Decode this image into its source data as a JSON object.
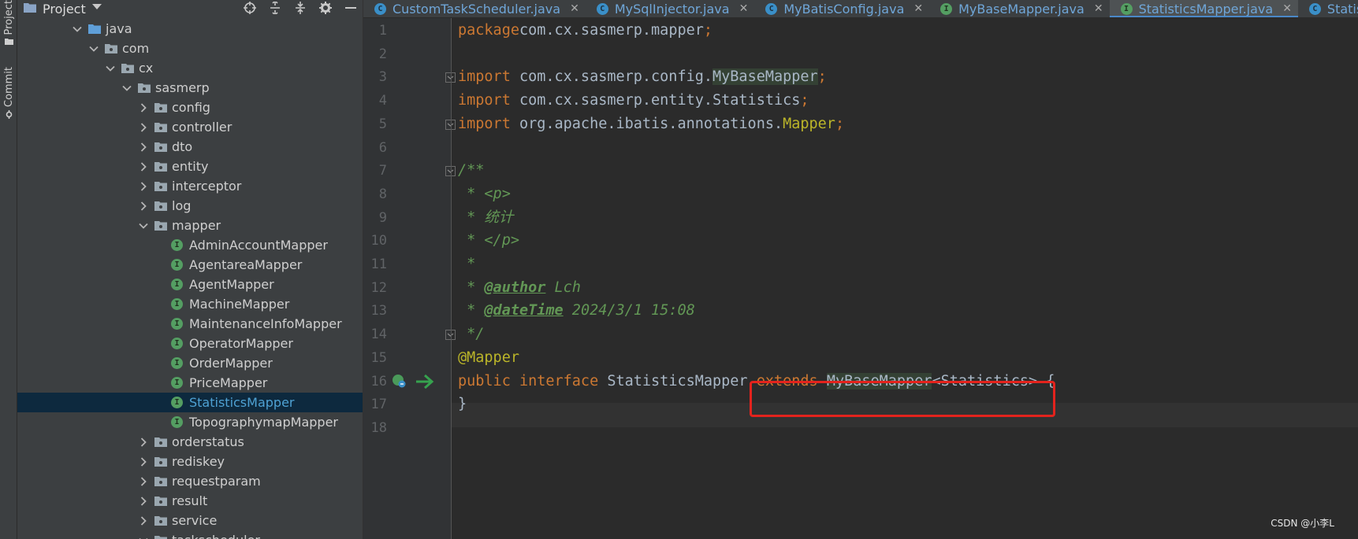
{
  "sidebar": {
    "project_tab": "Project",
    "commit_tab": "Commit"
  },
  "project_panel": {
    "title": "Project",
    "tree": [
      {
        "label": "java",
        "type": "folder",
        "level": 0,
        "expanded": true
      },
      {
        "label": "com",
        "type": "package",
        "level": 1,
        "expanded": true
      },
      {
        "label": "cx",
        "type": "package",
        "level": 2,
        "expanded": true
      },
      {
        "label": "sasmerp",
        "type": "package",
        "level": 3,
        "expanded": true
      },
      {
        "label": "config",
        "type": "package",
        "level": 4,
        "expanded": false
      },
      {
        "label": "controller",
        "type": "package",
        "level": 4,
        "expanded": false
      },
      {
        "label": "dto",
        "type": "package",
        "level": 4,
        "expanded": false
      },
      {
        "label": "entity",
        "type": "package",
        "level": 4,
        "expanded": false
      },
      {
        "label": "interceptor",
        "type": "package",
        "level": 4,
        "expanded": false
      },
      {
        "label": "log",
        "type": "package",
        "level": 4,
        "expanded": false
      },
      {
        "label": "mapper",
        "type": "package",
        "level": 4,
        "expanded": true
      },
      {
        "label": "AdminAccountMapper",
        "type": "interface",
        "level": 5
      },
      {
        "label": "AgentareaMapper",
        "type": "interface",
        "level": 5
      },
      {
        "label": "AgentMapper",
        "type": "interface",
        "level": 5
      },
      {
        "label": "MachineMapper",
        "type": "interface",
        "level": 5
      },
      {
        "label": "MaintenanceInfoMapper",
        "type": "interface",
        "level": 5
      },
      {
        "label": "OperatorMapper",
        "type": "interface",
        "level": 5
      },
      {
        "label": "OrderMapper",
        "type": "interface",
        "level": 5
      },
      {
        "label": "PriceMapper",
        "type": "interface",
        "level": 5
      },
      {
        "label": "StatisticsMapper",
        "type": "interface",
        "level": 5,
        "selected": true
      },
      {
        "label": "TopographymapMapper",
        "type": "interface",
        "level": 5
      },
      {
        "label": "orderstatus",
        "type": "package",
        "level": 4,
        "expanded": false
      },
      {
        "label": "rediskey",
        "type": "package",
        "level": 4,
        "expanded": false
      },
      {
        "label": "requestparam",
        "type": "package",
        "level": 4,
        "expanded": false
      },
      {
        "label": "result",
        "type": "package",
        "level": 4,
        "expanded": false
      },
      {
        "label": "service",
        "type": "package",
        "level": 4,
        "expanded": false
      },
      {
        "label": "taskscheduler",
        "type": "package",
        "level": 4,
        "expanded": true
      }
    ]
  },
  "tabs": [
    {
      "label": "CustomTaskScheduler.java",
      "kind": "c",
      "active": false
    },
    {
      "label": "MySqlInjector.java",
      "kind": "c",
      "active": false
    },
    {
      "label": "MyBatisConfig.java",
      "kind": "c",
      "active": false
    },
    {
      "label": "MyBaseMapper.java",
      "kind": "i",
      "active": false
    },
    {
      "label": "StatisticsMapper.java",
      "kind": "i",
      "active": true
    },
    {
      "label": "Statistics.java",
      "kind": "c",
      "active": false
    }
  ],
  "editor": {
    "line_numbers": [
      "1",
      "2",
      "3",
      "4",
      "5",
      "6",
      "7",
      "8",
      "9",
      "10",
      "11",
      "12",
      "13",
      "14",
      "15",
      "16",
      "17",
      "18"
    ],
    "lines": [
      {
        "tokens": [
          [
            "k",
            "package"
          ],
          [
            "",
            "com.cx.sasmerp.mapper"
          ],
          [
            "k",
            ";"
          ]
        ]
      },
      {
        "tokens": []
      },
      {
        "tokens": [
          [
            "k",
            "import"
          ],
          [
            "",
            " com.cx.sasmerp.config."
          ],
          [
            "hl",
            "MyBaseMapper"
          ],
          [
            "k",
            ";"
          ]
        ]
      },
      {
        "tokens": [
          [
            "k",
            "import"
          ],
          [
            "",
            " com.cx.sasmerp.entity.Statistics"
          ],
          [
            "k",
            ";"
          ]
        ]
      },
      {
        "tokens": [
          [
            "k",
            "import"
          ],
          [
            "",
            " org.apache.ibatis.annotations."
          ],
          [
            "ann",
            "Mapper"
          ],
          [
            "k",
            ";"
          ]
        ]
      },
      {
        "tokens": []
      },
      {
        "tokens": [
          [
            "cm",
            "/**"
          ]
        ]
      },
      {
        "tokens": [
          [
            "cm",
            " * <p>"
          ]
        ]
      },
      {
        "tokens": [
          [
            "cm",
            " * 统计"
          ]
        ]
      },
      {
        "tokens": [
          [
            "cm",
            " * </p>"
          ]
        ]
      },
      {
        "tokens": [
          [
            "cm",
            " *"
          ]
        ]
      },
      {
        "tokens": [
          [
            "cm",
            " * "
          ],
          [
            "cmtag",
            "@author"
          ],
          [
            "cm",
            " Lch"
          ]
        ]
      },
      {
        "tokens": [
          [
            "cm",
            " * "
          ],
          [
            "cmtag",
            "@dateTime"
          ],
          [
            "cm",
            " 2024/3/1 15:08"
          ]
        ]
      },
      {
        "tokens": [
          [
            "cm",
            " */"
          ]
        ]
      },
      {
        "tokens": [
          [
            "ann",
            "@Mapper"
          ]
        ]
      },
      {
        "tokens": [
          [
            "k",
            "public"
          ],
          [
            "",
            " "
          ],
          [
            "k",
            "interface"
          ],
          [
            "",
            " StatisticsMapper "
          ],
          [
            "k",
            "extends"
          ],
          [
            "",
            " "
          ],
          [
            "hl",
            "MyBaseMapper"
          ],
          [
            "",
            "<Statistics> {"
          ]
        ]
      },
      {
        "tokens": [
          [
            "",
            "}"
          ]
        ]
      },
      {
        "tokens": []
      }
    ]
  },
  "watermark": "CSDN @小李L",
  "colors": {
    "keyword": "#cc7832",
    "comment": "#629755",
    "annotation": "#bbb529",
    "highlight_box": "#e3231d"
  }
}
